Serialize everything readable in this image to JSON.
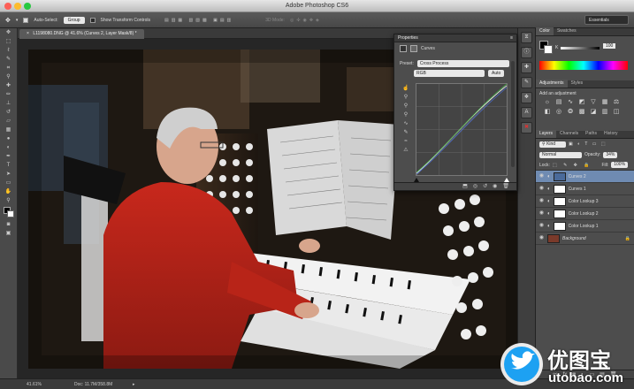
{
  "app": {
    "title": "Adobe Photoshop CS6"
  },
  "options_bar": {
    "auto_select_label": "Auto-Select:",
    "auto_select_value": "Group",
    "show_transform_label": "Show Transform Controls",
    "mode_3d_label": "3D Mode:",
    "workspace": "Essentials"
  },
  "document": {
    "tab_title": "L1198080.DNG @ 41.6% (Curves 2, Layer Mask/8) *"
  },
  "status": {
    "zoom": "41.61%",
    "doc": "Doc: 11.7M/358.8M"
  },
  "properties": {
    "tabs": [
      "Properties"
    ],
    "adjustment_name": "Curves",
    "preset_label": "Preset:",
    "preset_value": "Cross Process",
    "channel_value": "RGB",
    "auto_label": "Auto"
  },
  "color_panel": {
    "tabs": [
      "Color",
      "Swatches"
    ],
    "value": "100"
  },
  "adjustments_panel": {
    "tabs": [
      "Adjustments",
      "Styles"
    ],
    "add_label": "Add an adjustment"
  },
  "layers_panel": {
    "tabs": [
      "Layers",
      "Channels",
      "Paths",
      "History"
    ],
    "filter_kind": "Kind",
    "blend_mode": "Normal",
    "opacity_label": "Opacity:",
    "opacity_value": "34%",
    "lock_label": "Lock:",
    "fill_label": "Fill:",
    "fill_value": "100%",
    "layers": [
      {
        "name": "Curves 2",
        "selected": true
      },
      {
        "name": "Curves 1",
        "selected": false
      },
      {
        "name": "Color Lookup 3",
        "selected": false
      },
      {
        "name": "Color Lookup 2",
        "selected": false
      },
      {
        "name": "Color Lookup 1",
        "selected": false
      },
      {
        "name": "Background",
        "selected": false
      }
    ]
  },
  "watermark": {
    "cn": "优图宝",
    "url": "utobao.com"
  }
}
